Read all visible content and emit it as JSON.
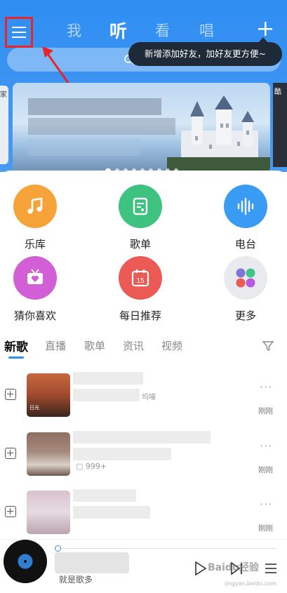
{
  "header": {
    "tabs": [
      {
        "label": "我",
        "active": false
      },
      {
        "label": "听",
        "active": true
      },
      {
        "label": "看",
        "active": false
      },
      {
        "label": "唱",
        "active": false
      }
    ],
    "plus_icon": "plus-icon",
    "menu_icon": "hamburger-menu-icon",
    "tooltip": "新增添加好友，加好友更方便~",
    "search_icon": "search-icon"
  },
  "banner": {
    "left_edge_label": "家",
    "right_edge_label": "酷",
    "page_count": 9,
    "active_page": 1
  },
  "shortcuts": [
    {
      "label": "乐库",
      "icon": "music-note-icon",
      "color": "#f6a43a"
    },
    {
      "label": "歌单",
      "icon": "playlist-icon",
      "color": "#3ec27f"
    },
    {
      "label": "电台",
      "icon": "soundwave-icon",
      "color": "#3a9bf4"
    },
    {
      "label": "猜你喜欢",
      "icon": "heart-tv-icon",
      "color": "#d25fd6"
    },
    {
      "label": "每日推荐",
      "icon": "calendar-icon",
      "color": "#ec5a55",
      "badge": "15"
    },
    {
      "label": "更多",
      "icon": "more-apps-icon",
      "color": "#e9eaed"
    }
  ],
  "categories": [
    {
      "label": "新歌",
      "active": true
    },
    {
      "label": "直播",
      "active": false
    },
    {
      "label": "歌单",
      "active": false
    },
    {
      "label": "资讯",
      "active": false
    },
    {
      "label": "视频",
      "active": false
    }
  ],
  "filter_icon": "filter-icon",
  "songs": [
    {
      "fragment": "坞喵",
      "comments": "",
      "time": "刚刚",
      "cover_caption": "日光"
    },
    {
      "fragment": "",
      "comments": "999+",
      "time": "刚刚",
      "cover_caption": ""
    },
    {
      "fragment": "",
      "comments": "",
      "time": "刚刚",
      "cover_caption": ""
    }
  ],
  "player": {
    "subtitle": "就是歌多",
    "progress": 0.0,
    "watermark": "Baidu经验",
    "watermark_sub": "jingyan.baidu.com"
  },
  "colors": {
    "brand_blue": "#2f8ef3",
    "highlight_red": "#e8262a",
    "tooltip_bg": "#1f2a38"
  }
}
